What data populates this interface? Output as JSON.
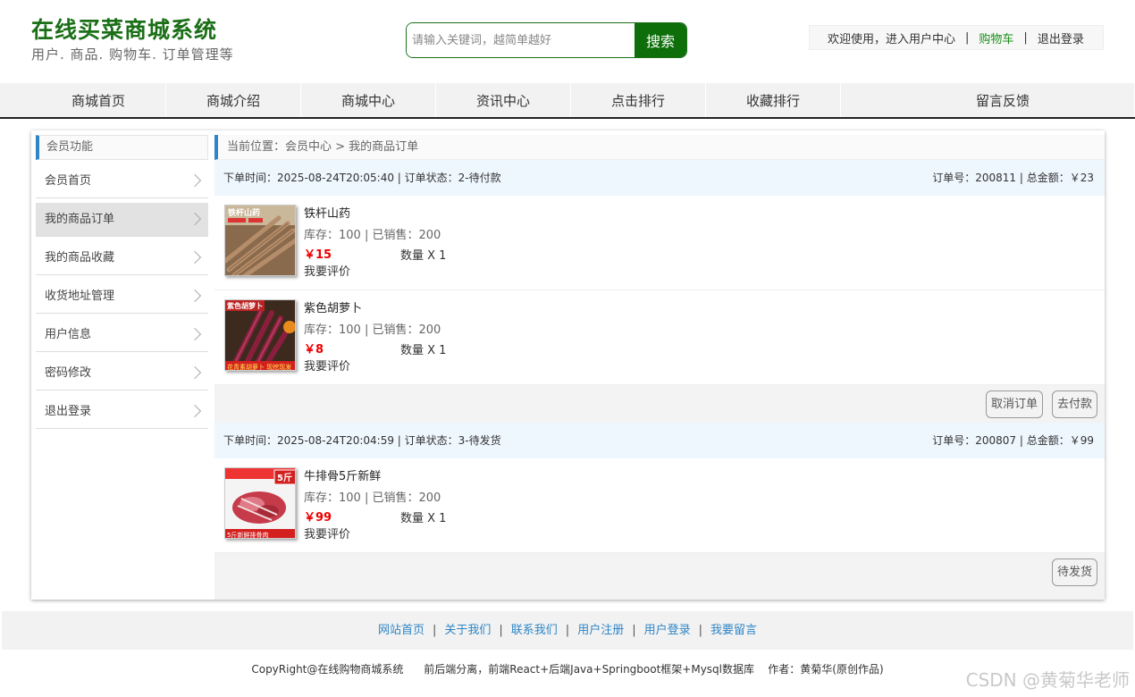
{
  "header": {
    "title": "在线买菜商城系统",
    "subtitle": "用户. 商品. 购物车. 订单管理等",
    "search_placeholder": "请输入关键词，越简单越好",
    "search_button": "搜索",
    "welcome": "欢迎使用，进入用户中心",
    "cart": "购物车",
    "logout": "退出登录"
  },
  "nav": [
    "商城首页",
    "商城介绍",
    "商城中心",
    "资讯中心",
    "点击排行",
    "收藏排行",
    "留言反馈"
  ],
  "sidebar": {
    "title": "会员功能",
    "items": [
      "会员首页",
      "我的商品订单",
      "我的商品收藏",
      "收货地址管理",
      "用户信息",
      "密码修改",
      "退出登录"
    ]
  },
  "breadcrumb": "当前位置：会员中心 > 我的商品订单",
  "orders": [
    {
      "time_status": "下单时间：2025-08-24T20:05:40 | 订单状态：2-待付款",
      "no_total": "订单号：200811 | 总金额：￥23",
      "products": [
        {
          "name": "铁杆山药",
          "stock": "库存：100 | 已销售：200",
          "price": "￥15",
          "qty": "数量 X 1",
          "review": "我要评价"
        },
        {
          "name": "紫色胡萝卜",
          "stock": "库存：100 | 已销售：200",
          "price": "￥8",
          "qty": "数量 X 1",
          "review": "我要评价"
        }
      ],
      "actions": [
        "取消订单",
        "去付款"
      ]
    },
    {
      "time_status": "下单时间：2025-08-24T20:04:59 | 订单状态：3-待发货",
      "no_total": "订单号：200807 | 总金额：￥99",
      "products": [
        {
          "name": "牛排骨5斤新鲜",
          "stock": "库存：100 | 已销售：200",
          "price": "￥99",
          "qty": "数量 X 1",
          "review": "我要评价"
        }
      ],
      "actions": [
        "待发货"
      ]
    }
  ],
  "thumb_text": {
    "yam": "铁杆山药",
    "carrot": "紫色胡萝卜",
    "carrot_banner": "花青素胡萝卜 现挖现发",
    "rib_weight": "5斤",
    "rib_banner": "5斤新鲜排骨肉"
  },
  "footer": {
    "links": [
      "网站首页",
      "关于我们",
      "联系我们",
      "用户注册",
      "用户登录",
      "我要留言"
    ],
    "copyright": "CopyRight@在线购物商城系统      前后端分离，前端React+后端Java+Springboot框架+Mysql数据库    作者：黄菊华(原创作品)",
    "watermark": "CSDN @黄菊华老师"
  },
  "colors": {
    "brand_green": "#1b6f17",
    "accent_blue": "#2f86c6",
    "price_red": "#ee0000"
  }
}
